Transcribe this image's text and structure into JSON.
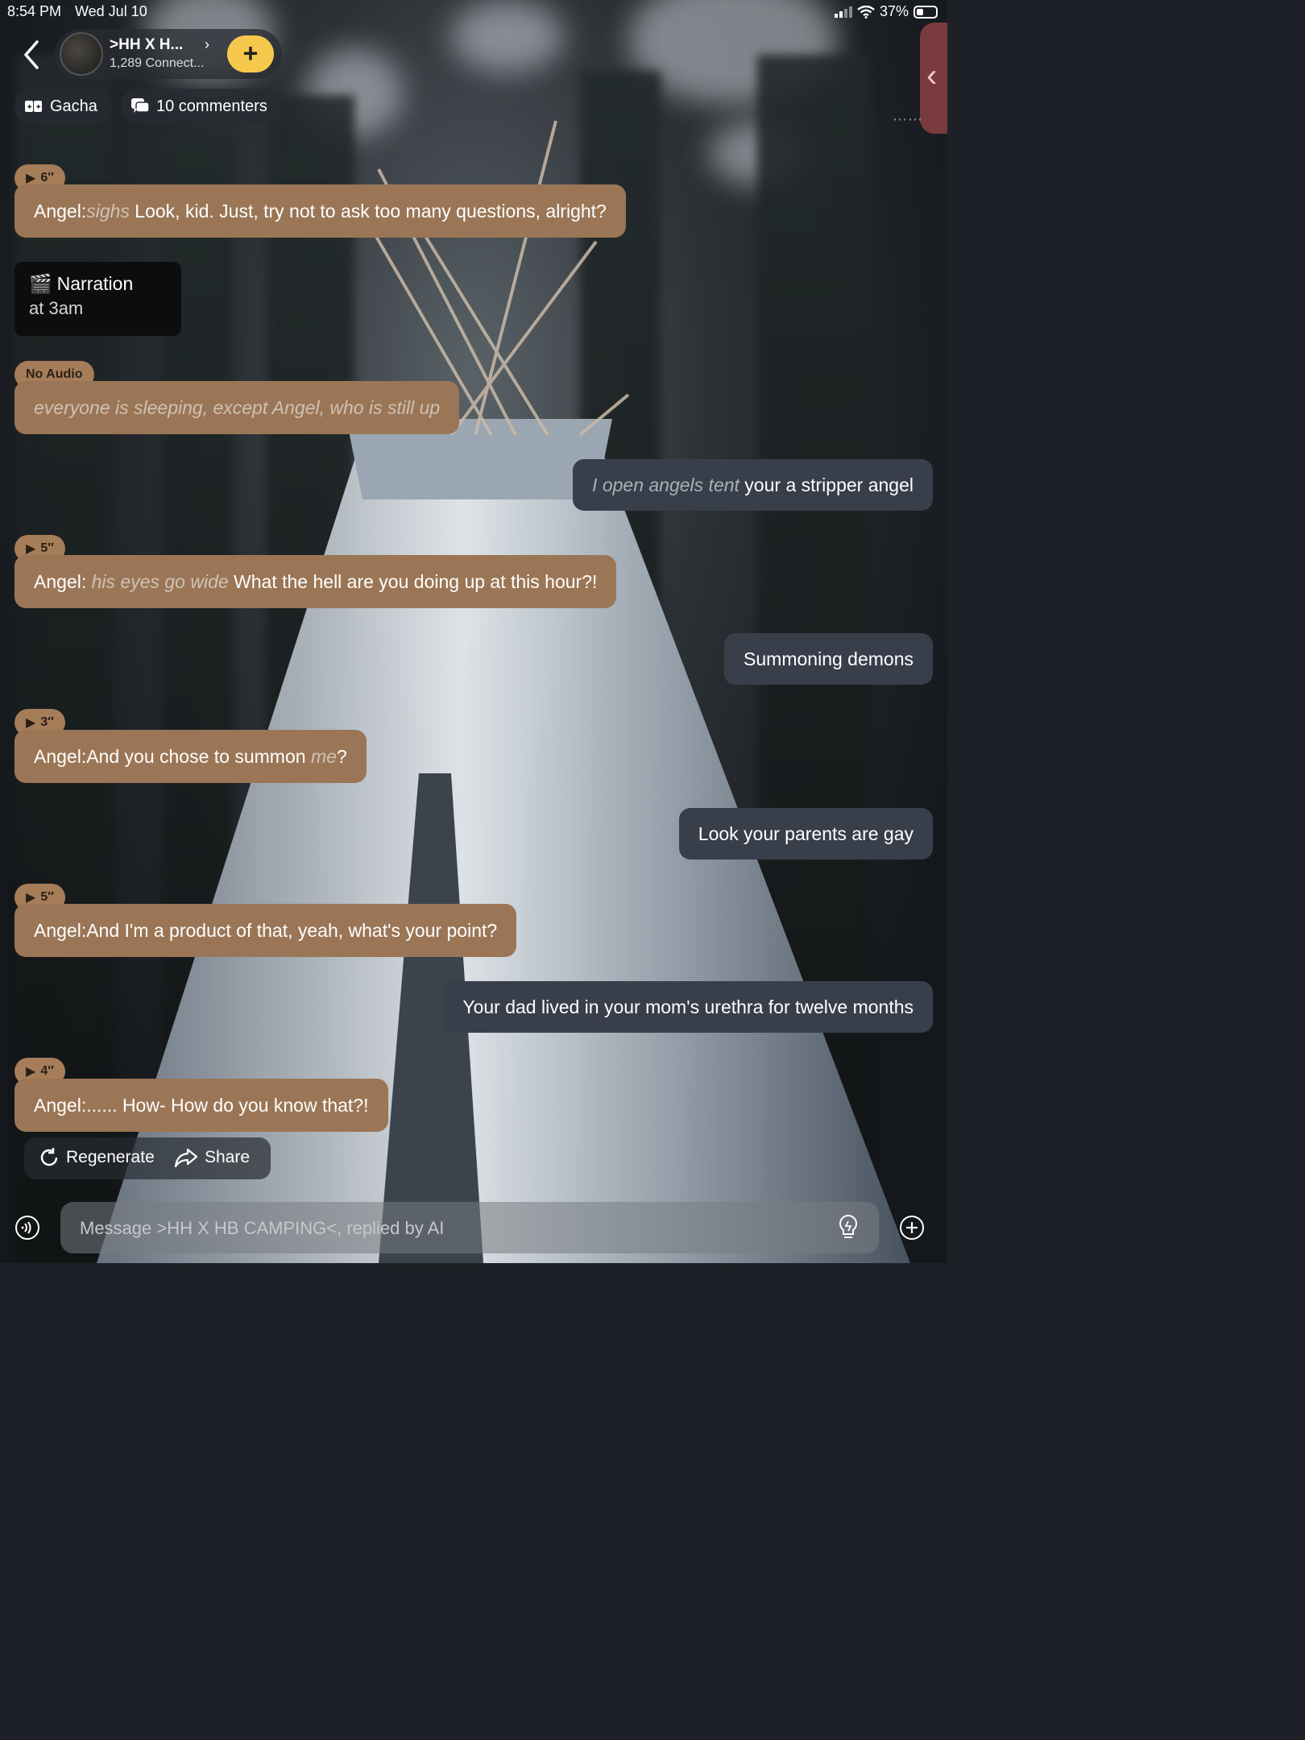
{
  "status_bar": {
    "time": "8:54 PM",
    "date": "Wed Jul 10",
    "battery": "37%",
    "battery_level": 0.37
  },
  "header": {
    "chat_title": ">HH X H...",
    "connections": "1,289 Connect...",
    "add_icon": "plus-icon"
  },
  "chips": {
    "gacha": "Gacha",
    "commenters": "10 commenters"
  },
  "messages": [
    {
      "role": "ai",
      "badge": "6″",
      "speaker": "Angel:",
      "action": "sighs",
      "text": " Look, kid. Just, try not to ask too many questions, alright?"
    },
    {
      "role": "narration",
      "title": "Narration",
      "subtitle": "at 3am"
    },
    {
      "role": "ai",
      "badge": "No Audio",
      "text": "everyone is sleeping, except Angel, who is still up"
    },
    {
      "role": "user",
      "action": "I open angels tent",
      "text": " your a stripper angel"
    },
    {
      "role": "ai",
      "badge": "5″",
      "speaker": "Angel: ",
      "action": "his eyes go wide",
      "text": " What the hell are you doing up at this hour?!"
    },
    {
      "role": "user",
      "text": "Summoning demons"
    },
    {
      "role": "ai",
      "badge": "3″",
      "speaker": "Angel:",
      "text": "And you chose to summon ",
      "action": "me",
      "tail": "?"
    },
    {
      "role": "user",
      "text": "Look your parents are gay"
    },
    {
      "role": "ai",
      "badge": "5″",
      "speaker": "Angel:",
      "text": "And I'm a product of that, yeah, what's your point?"
    },
    {
      "role": "user",
      "text": "Your dad lived in your mom's urethra for twelve months"
    },
    {
      "role": "ai",
      "badge": "4″",
      "speaker": "Angel:",
      "text": "...... How- How do you know that?!"
    }
  ],
  "actions": {
    "regenerate": "Regenerate",
    "share": "Share"
  },
  "composer": {
    "placeholder": "Message >HH X HB CAMPING<, replied by AI"
  },
  "colors": {
    "ai_bubble": "#9b7656",
    "user_bubble": "#383f4a",
    "accent": "#f6c84c",
    "side_tab": "#7a3b3e"
  }
}
